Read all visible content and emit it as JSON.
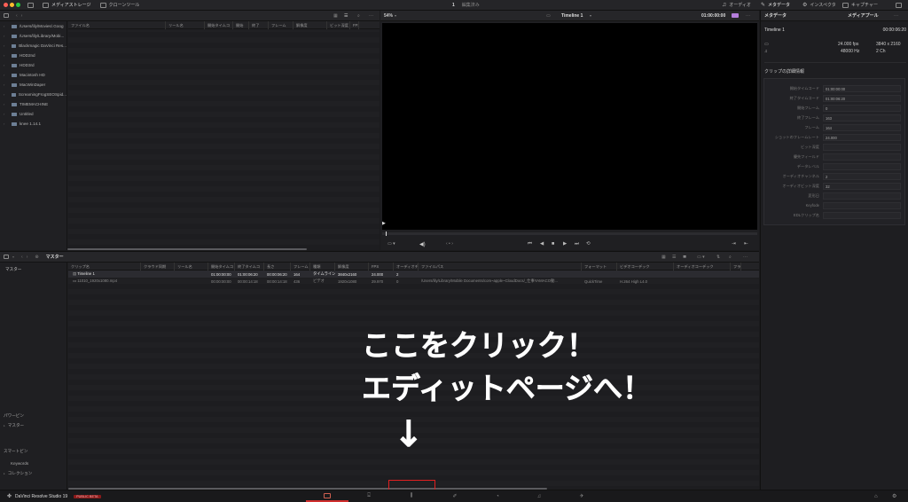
{
  "titlebar": {
    "media_storage": "メディアストレージ",
    "clone_tool": "クローンツール",
    "project_num": "1",
    "project_status": "編集済み",
    "audio": "オーディオ",
    "metadata": "メタデータ",
    "inspector": "インスペクタ",
    "capture": "キャプチャー"
  },
  "storage": {
    "items": [
      "/Users/lily/Movies/.Goog",
      "/Users/lily/Library/Mobi...",
      "Blackmagic DaVinci Res...",
      "HDD2nd",
      "HDD3rd",
      "Macintosh HD",
      "MacWinDaper",
      "ScreamingFrogSEOSpid...",
      "TIMEMACHINE",
      "Untitled",
      "knee 1.14.1"
    ],
    "columns": [
      "ファイル名",
      "リール名",
      "開始タイムコ",
      "開始",
      "終了",
      "フレーム",
      "解像度",
      "ビット深度",
      "FPS"
    ]
  },
  "viewer": {
    "zoom": "54%",
    "timeline_name": "Timeline 1",
    "timecode": "01:00:00:00"
  },
  "metadata_panel": {
    "title": "Timeline 1",
    "duration": "00:00:06:20",
    "fps": "24.000 fps",
    "resolution": "3840 x 2160",
    "hz": "48000 Hz",
    "channels": "2 Ch",
    "section": "クリップの詳細情報",
    "fields": [
      {
        "label": "開始タイムコード",
        "value": "01:00:00:00"
      },
      {
        "label": "終了タイムコード",
        "value": "01:00:06:20"
      },
      {
        "label": "開始フレーム",
        "value": "0"
      },
      {
        "label": "終了フレーム",
        "value": "163"
      },
      {
        "label": "フレーム",
        "value": "164"
      },
      {
        "label": "ショットのフレームレート",
        "value": "24.000"
      },
      {
        "label": "ビット深度",
        "value": ""
      },
      {
        "label": "優先フィールド",
        "value": ""
      },
      {
        "label": "データレベル",
        "value": ""
      },
      {
        "label": "オーディオチャンネル",
        "value": "2"
      },
      {
        "label": "オーディオビット深度",
        "value": "32"
      },
      {
        "label": "変形日",
        "value": ""
      },
      {
        "label": "Keyfode",
        "value": ""
      },
      {
        "label": "EDLクリップ名",
        "value": ""
      }
    ]
  },
  "media_pool": {
    "header": "マスター",
    "sidebar_master": "マスター",
    "power_bins": "パワービン",
    "power_bin_master": "マスター",
    "smart_bins": "スマートビン",
    "keywords": "Keywords",
    "collection": "コレクション",
    "columns": [
      "クリップ名",
      "クラウド同期",
      "リール名",
      "開始タイムコ",
      "終了タイムコ",
      "長さ",
      "フレーム",
      "種類",
      "解像度",
      "FPS",
      "オーディオチ",
      "ファイルパス",
      "フォーマット",
      "ビデオコーデック",
      "オーディオコーデック",
      "フラグ"
    ],
    "rows": [
      [
        "Timeline 1",
        "",
        "",
        "01:00:00:00",
        "01:00:06:20",
        "00:00:06:20",
        "164",
        "タイムライン",
        "3840x2160",
        "24.000",
        "2",
        "",
        "",
        "",
        "",
        ""
      ],
      [
        "11010_1920x1080.mp4",
        "",
        "",
        "00:00:00:00",
        "00:00:14:18",
        "00:00:14:18",
        "436",
        "ビデオ",
        "1920x1080",
        "29.970",
        "0",
        "/Users/lily/Library/Mobile Documents/com~apple~CloudDocs/_仕事YAMACO動...",
        "QuickTime",
        "H.264 High L4.0",
        "",
        ""
      ]
    ]
  },
  "annotation": {
    "line1": "ここをクリック！",
    "line2": "エディットページへ！",
    "arrow": "↓"
  },
  "footer": {
    "app_name": "DaVinci Resolve Studio 19",
    "badge": "PUBLIC BETA"
  }
}
